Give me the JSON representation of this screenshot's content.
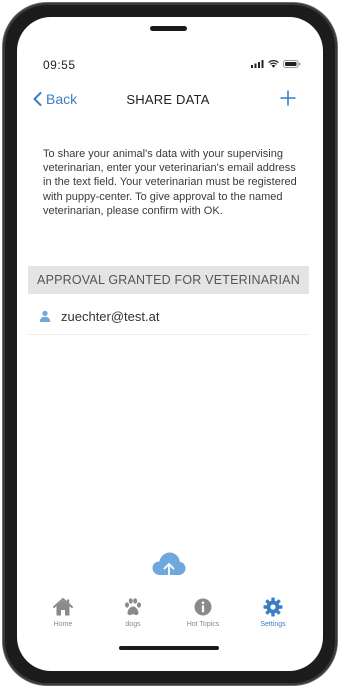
{
  "status_bar": {
    "time": "09:55"
  },
  "nav": {
    "back_label": "Back",
    "title": "SHARE DATA",
    "add_icon": "plus-icon"
  },
  "description": "To share your animal's data with your supervising veterinarian, enter your veterinarian's email address in the text field. Your veterinarian must be registered with puppy-center. To give approval to the named veterinarian, please confirm with OK.",
  "approval_section": {
    "header": "APPROVAL GRANTED FOR VETERINARIAN",
    "veterinarians": [
      {
        "email": "zuechter@test.at",
        "icon": "user-icon"
      }
    ]
  },
  "upload_button": {
    "icon": "cloud-upload-icon"
  },
  "tabbar": {
    "items": [
      {
        "label": "Home",
        "icon": "home-icon",
        "active": false
      },
      {
        "label": "dogs",
        "icon": "paw-icon",
        "active": false
      },
      {
        "label": "Hot Topics",
        "icon": "info-icon",
        "active": false
      },
      {
        "label": "Settings",
        "icon": "gear-icon",
        "active": true
      }
    ]
  },
  "colors": {
    "accent": "#3a7fc1",
    "tab_inactive": "#8a8a8a",
    "section_header_bg": "#e4e4e4",
    "upload_cloud": "#6fa8dc"
  }
}
